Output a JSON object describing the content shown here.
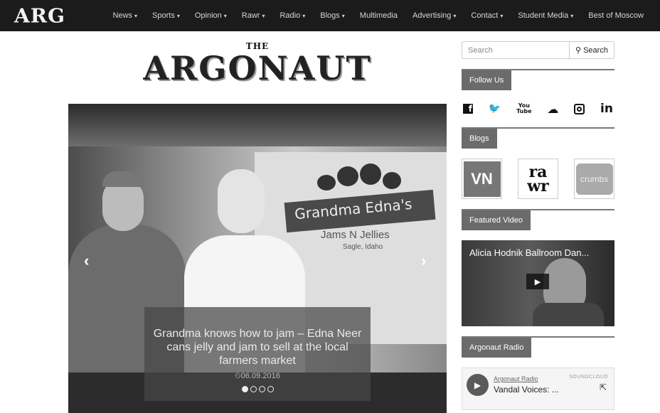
{
  "nav": {
    "brand": "ARG",
    "items": [
      {
        "label": "News",
        "caret": "▾"
      },
      {
        "label": "Sports",
        "caret": "▾"
      },
      {
        "label": "Opinion",
        "caret": "▾"
      },
      {
        "label": "Rawr",
        "caret": "▾"
      },
      {
        "label": "Radio",
        "caret": "▾"
      },
      {
        "label": "Blogs",
        "caret": "▾"
      },
      {
        "label": "Multimedia",
        "caret": ""
      },
      {
        "label": "Advertising",
        "caret": "▾"
      },
      {
        "label": "Contact",
        "caret": "▾"
      },
      {
        "label": "Student Media",
        "caret": "▾"
      },
      {
        "label": "Best of Moscow",
        "caret": ""
      }
    ]
  },
  "logo": {
    "the": "THE",
    "name": "ARGONAUT"
  },
  "hero": {
    "prev_arrow": "‹",
    "next_arrow": "›",
    "sign_line1": "Grandma Edna's",
    "sign_line2": "Jams N Jellies",
    "sign_line3": "Sagle, Idaho",
    "caption_title": "Grandma knows how to jam – Edna Neer cans jelly and jam to sell at the local farmers market",
    "caption_date_icon": "⏲",
    "caption_date": "06.09.2016",
    "active_slide": 1,
    "slide_count": 4
  },
  "sidebar": {
    "search": {
      "placeholder": "Search",
      "button_label": "Search",
      "button_icon": "⚲"
    },
    "follow": {
      "label": "Follow Us",
      "icons": [
        {
          "name": "facebook-icon",
          "glyph": "f"
        },
        {
          "name": "twitter-icon",
          "glyph": "🐦"
        },
        {
          "name": "youtube-icon",
          "glyph": "You\nTube"
        },
        {
          "name": "soundcloud-icon",
          "glyph": "☁"
        },
        {
          "name": "instagram-icon",
          "glyph": ""
        },
        {
          "name": "linkedin-icon",
          "glyph": "in"
        }
      ]
    },
    "blogs": {
      "label": "Blogs",
      "tiles": [
        {
          "name": "vandal-nation-blog",
          "text": "VN"
        },
        {
          "name": "rawr-blog",
          "text": "ra\nwr"
        },
        {
          "name": "crumbs-blog",
          "text": "crumbs"
        }
      ]
    },
    "video": {
      "label": "Featured Video",
      "title": "Alicia Hodnik Ballroom Dan...",
      "play_glyph": "▶"
    },
    "radio": {
      "label": "Argonaut Radio",
      "source": "Argonaut Radio",
      "track": "Vandal Voices: ...",
      "provider": "SOUNDCLOUD",
      "play_glyph": "▶",
      "share_glyph": "⇱"
    }
  }
}
